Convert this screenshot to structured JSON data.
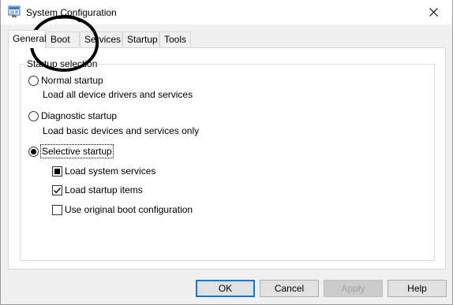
{
  "window": {
    "title": "System Configuration",
    "icon": "msconfig-app-icon",
    "close_icon": "close-icon"
  },
  "tabs": [
    {
      "label": "General",
      "active": true
    },
    {
      "label": "Boot",
      "active": false
    },
    {
      "label": "Services",
      "active": false
    },
    {
      "label": "Startup",
      "active": false
    },
    {
      "label": "Tools",
      "active": false
    }
  ],
  "startup_selection": {
    "group_label": "Startup selection",
    "normal": {
      "label": "Normal startup",
      "description": "Load all device drivers and services",
      "checked": false
    },
    "diagnostic": {
      "label": "Diagnostic startup",
      "description": "Load basic devices and services only",
      "checked": false
    },
    "selective": {
      "label": "Selective startup",
      "checked": true
    },
    "options": [
      {
        "label": "Load system services",
        "state": "indeterminate"
      },
      {
        "label": "Load startup items",
        "state": "checked"
      },
      {
        "label": "Use original boot configuration",
        "state": "unchecked"
      }
    ]
  },
  "buttons": {
    "ok": "OK",
    "cancel": "Cancel",
    "apply": "Apply",
    "help": "Help"
  },
  "annotation": {
    "shape": "hand-drawn circle",
    "color": "#000000",
    "target": "Boot tab"
  }
}
